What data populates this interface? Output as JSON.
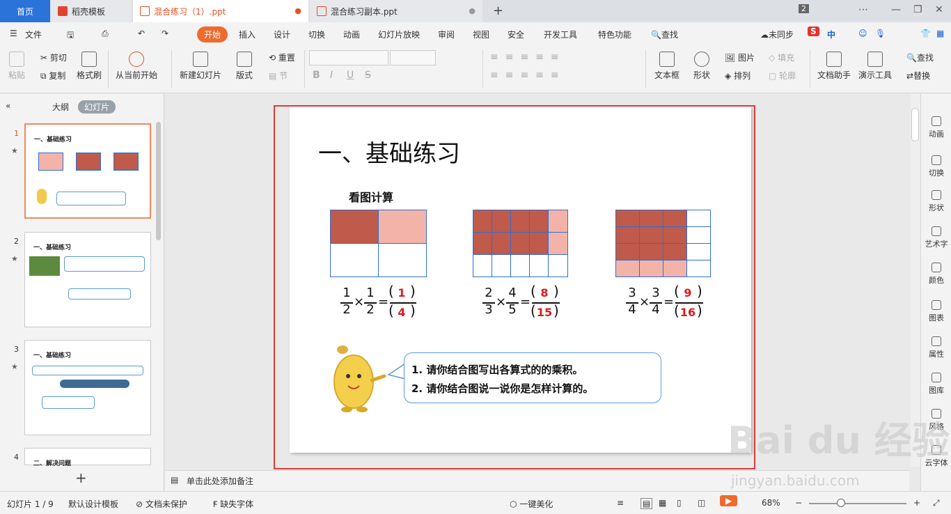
{
  "tabs": {
    "home": "首页",
    "template": "稻壳模板",
    "doc1": "混合练习（1）.ppt",
    "doc2": "混合练习副本.ppt",
    "window_count": "2"
  },
  "menu": {
    "file": "文件",
    "items": [
      "开始",
      "插入",
      "设计",
      "切换",
      "动画",
      "幻灯片放映",
      "审阅",
      "视图",
      "安全",
      "开发工具",
      "特色功能"
    ],
    "search": "查找",
    "sync": "未同步"
  },
  "toolbar": {
    "paste": "粘贴",
    "cut": "剪切",
    "copy": "复制",
    "format_painter": "格式刷",
    "from_current": "从当前开始",
    "new_slide": "新建幻灯片",
    "layout": "版式",
    "reset": "重置",
    "section": "节",
    "textbox": "文本框",
    "shape": "形状",
    "picture": "图片",
    "arrange": "排列",
    "fill": "填充",
    "outline": "轮廓",
    "doc_helper": "文档助手",
    "present_tools": "演示工具",
    "find": "查找",
    "replace": "替换"
  },
  "left_panel": {
    "outline_tab": "大纲",
    "slides_tab": "幻灯片",
    "thumbs": [
      {
        "num": "1",
        "title": "一、基础练习"
      },
      {
        "num": "2",
        "title": "一、基础练习"
      },
      {
        "num": "3",
        "title": "一、基础练习"
      },
      {
        "num": "4",
        "title": "二、解决问题"
      }
    ]
  },
  "slide": {
    "title": "一、基础练习",
    "subtitle": "看图计算",
    "problems": [
      {
        "a_num": "1",
        "a_den": "2",
        "b_num": "1",
        "b_den": "2",
        "ans_num": "1",
        "ans_den": "4"
      },
      {
        "a_num": "2",
        "a_den": "3",
        "b_num": "4",
        "b_den": "5",
        "ans_num": "8",
        "ans_den": "15"
      },
      {
        "a_num": "3",
        "a_den": "4",
        "b_num": "3",
        "b_den": "4",
        "ans_num": "9",
        "ans_den": "16"
      }
    ],
    "bubble": [
      "1. 请你结合图写出各算式的的乘积。",
      "2. 请你结合图说一说你是怎样计算的。"
    ]
  },
  "right_rail": [
    "动画",
    "切换",
    "形状",
    "艺术字",
    "颜色",
    "图表",
    "属性",
    "图库",
    "风格",
    "云字体"
  ],
  "notes": "单击此处添加备注",
  "status": {
    "slide_pos": "幻灯片 1 / 9",
    "design": "默认设计模板",
    "protect": "文档未保护",
    "missing_font": "缺失字体",
    "beautify": "一键美化",
    "zoom": "68%"
  },
  "watermark": {
    "main": "Bai du 经验",
    "url": "jingyan.baidu.com"
  }
}
